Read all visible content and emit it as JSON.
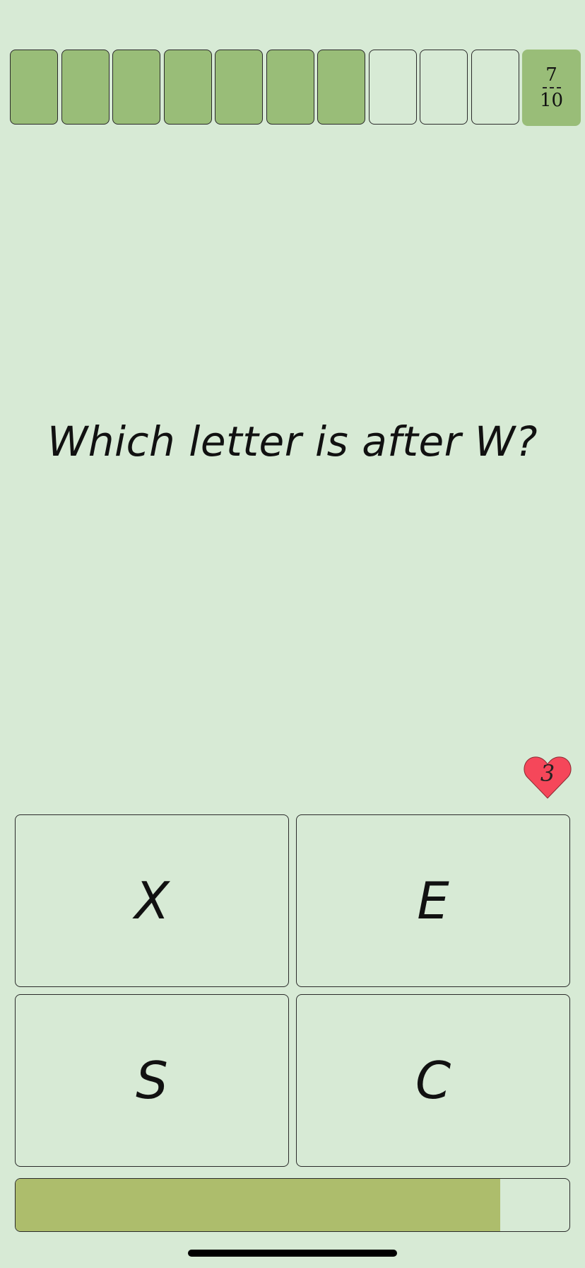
{
  "progress": {
    "total": 10,
    "completed": 7,
    "score_numerator": "7",
    "score_denominator": "10",
    "filled_color": "#99bd78",
    "empty_color": "#d7ead5"
  },
  "question": {
    "text": "Which letter is after W?"
  },
  "lives": {
    "count": "3",
    "icon": "heart-icon",
    "color": "#f5475a"
  },
  "answers": [
    {
      "label": "X"
    },
    {
      "label": "E"
    },
    {
      "label": "S"
    },
    {
      "label": "C"
    }
  ],
  "timer": {
    "remaining_fraction": 0.875,
    "fill_color": "#adbd6c"
  },
  "colors": {
    "background": "#d7ead5"
  }
}
